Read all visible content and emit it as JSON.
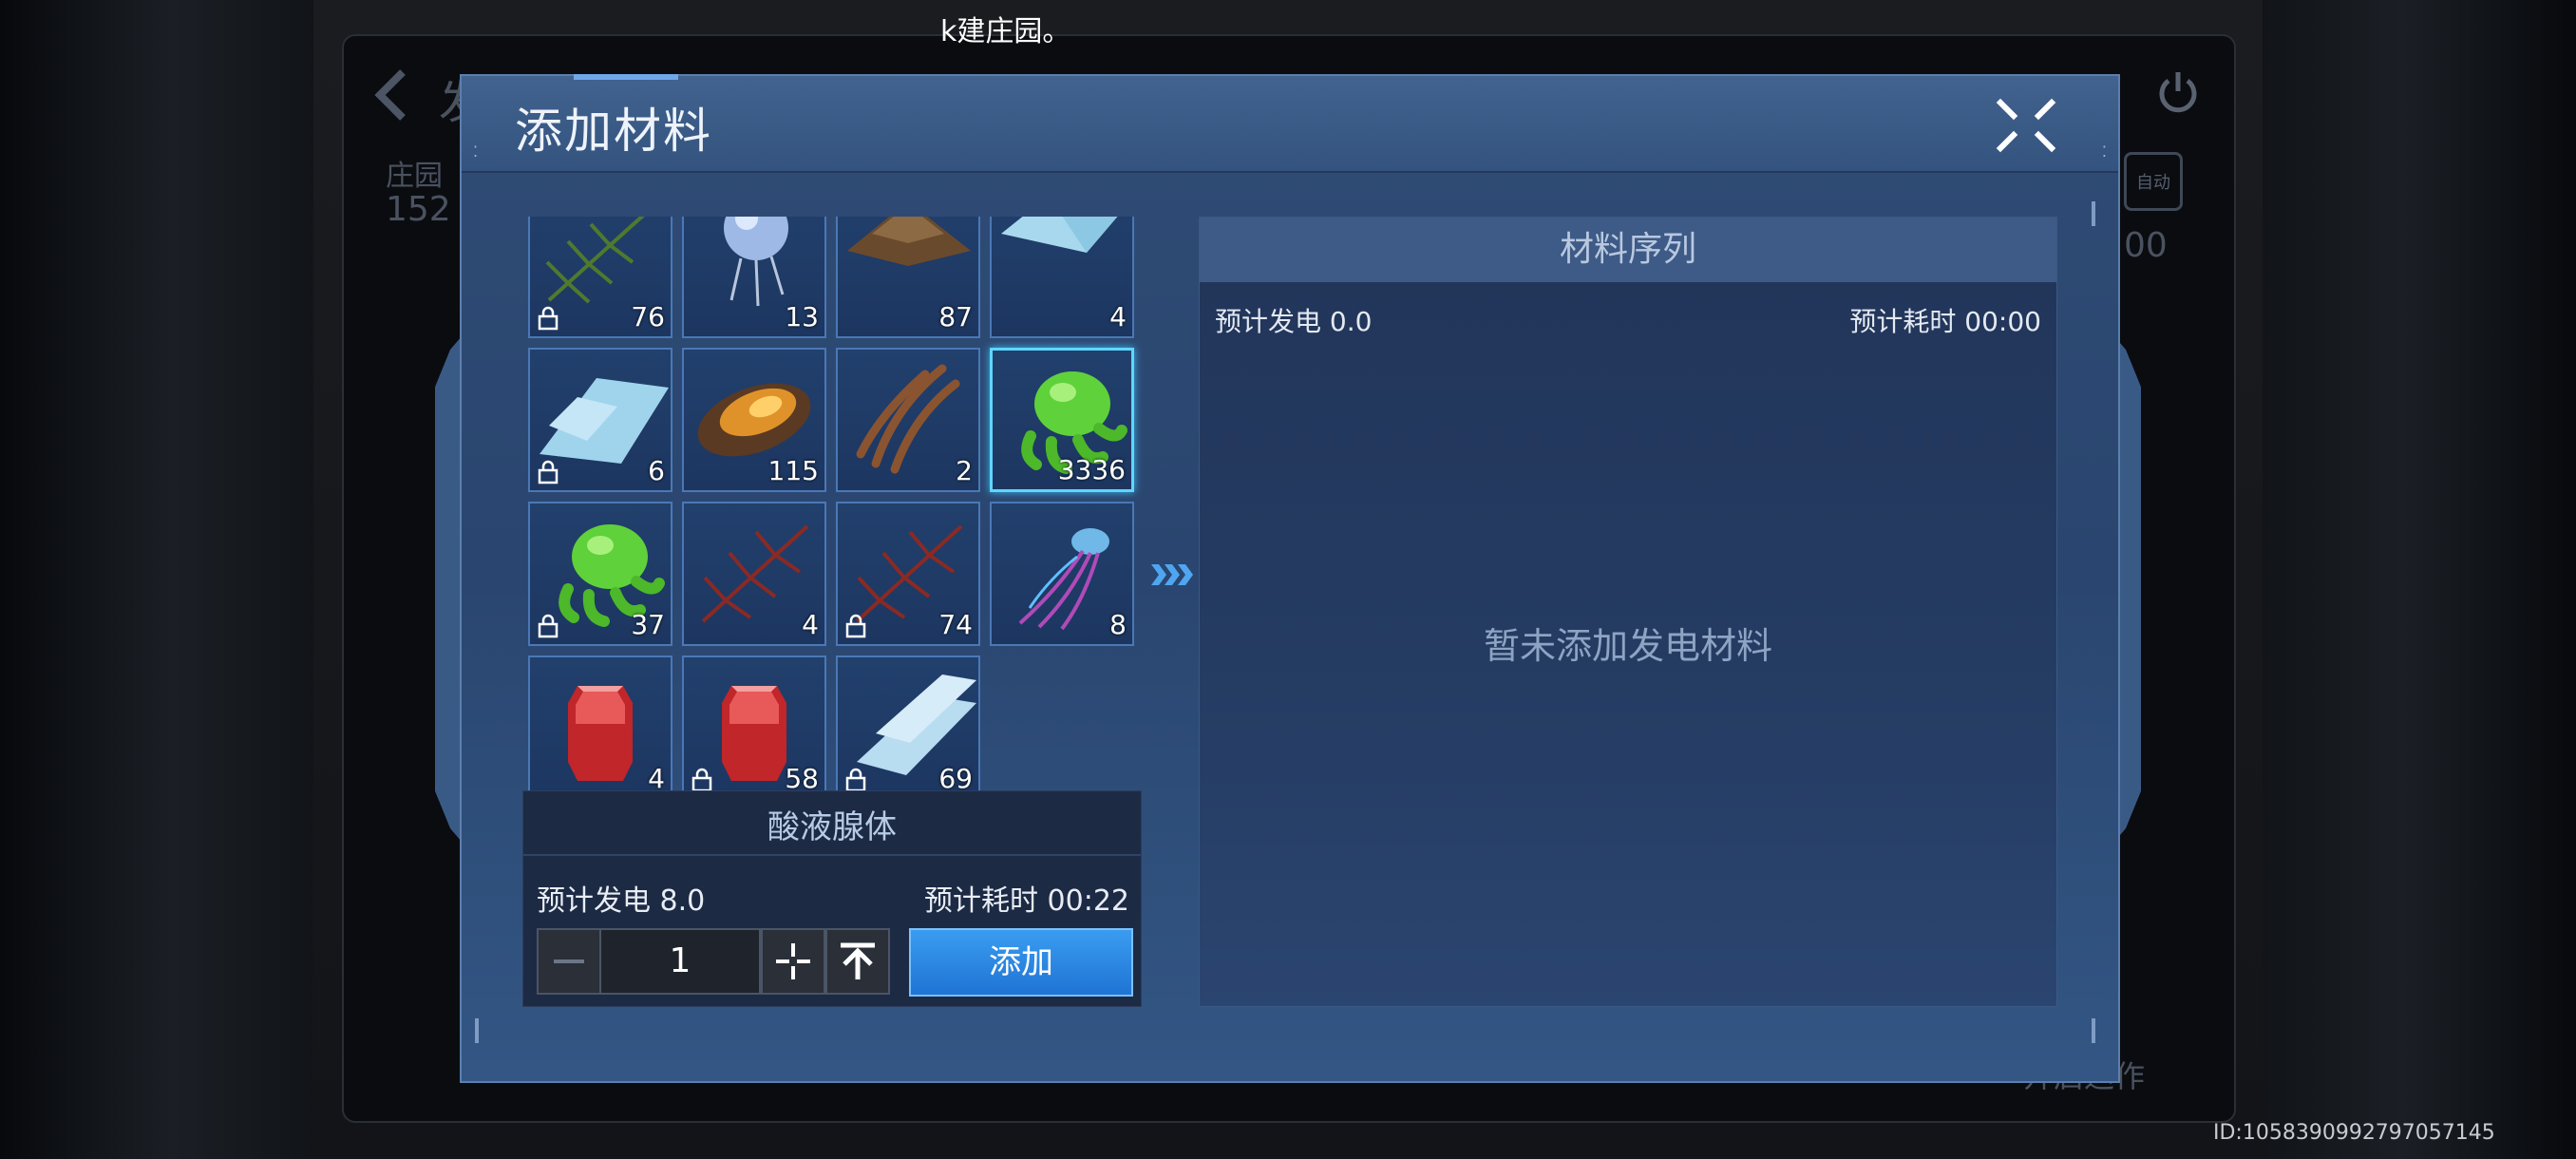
{
  "toast": "建庄园。",
  "toast_fragment": "k",
  "background": {
    "ghost_title": "发",
    "ghost_label": "庄园",
    "ghost_value": "152",
    "ghost_time": "00",
    "ghost_action": "开启运作",
    "auto_label": "自动"
  },
  "id_text": "ID:1058390992797057145",
  "dialog": {
    "title": "添加材料",
    "items": [
      {
        "count": "76",
        "locked": true,
        "art": "pine-branch"
      },
      {
        "count": "13",
        "locked": false,
        "art": "blue-orb"
      },
      {
        "count": "87",
        "locked": false,
        "art": "brown-mound"
      },
      {
        "count": "4",
        "locked": false,
        "art": "ice-shard"
      },
      {
        "count": "6",
        "locked": true,
        "art": "ice-sheet"
      },
      {
        "count": "115",
        "locked": false,
        "art": "amber-shell"
      },
      {
        "count": "2",
        "locked": false,
        "art": "brown-strips"
      },
      {
        "count": "3336",
        "locked": false,
        "art": "green-slime",
        "selected": true
      },
      {
        "count": "37",
        "locked": true,
        "art": "green-slime"
      },
      {
        "count": "4",
        "locked": false,
        "art": "red-branch"
      },
      {
        "count": "74",
        "locked": true,
        "art": "red-branch"
      },
      {
        "count": "8",
        "locked": false,
        "art": "jellyfish"
      },
      {
        "count": "4",
        "locked": false,
        "art": "red-crystal"
      },
      {
        "count": "58",
        "locked": true,
        "art": "red-crystal"
      },
      {
        "count": "69",
        "locked": true,
        "art": "ice-plate"
      }
    ],
    "detail": {
      "name": "酸液腺体",
      "power": "预计发电 8.0",
      "time": "预计耗时 00:22",
      "quantity": "1",
      "add_label": "添加"
    },
    "sequence": {
      "header": "材料序列",
      "power": "预计发电 0.0",
      "time": "预计耗时 00:00",
      "empty": "暂未添加发电材料"
    }
  }
}
